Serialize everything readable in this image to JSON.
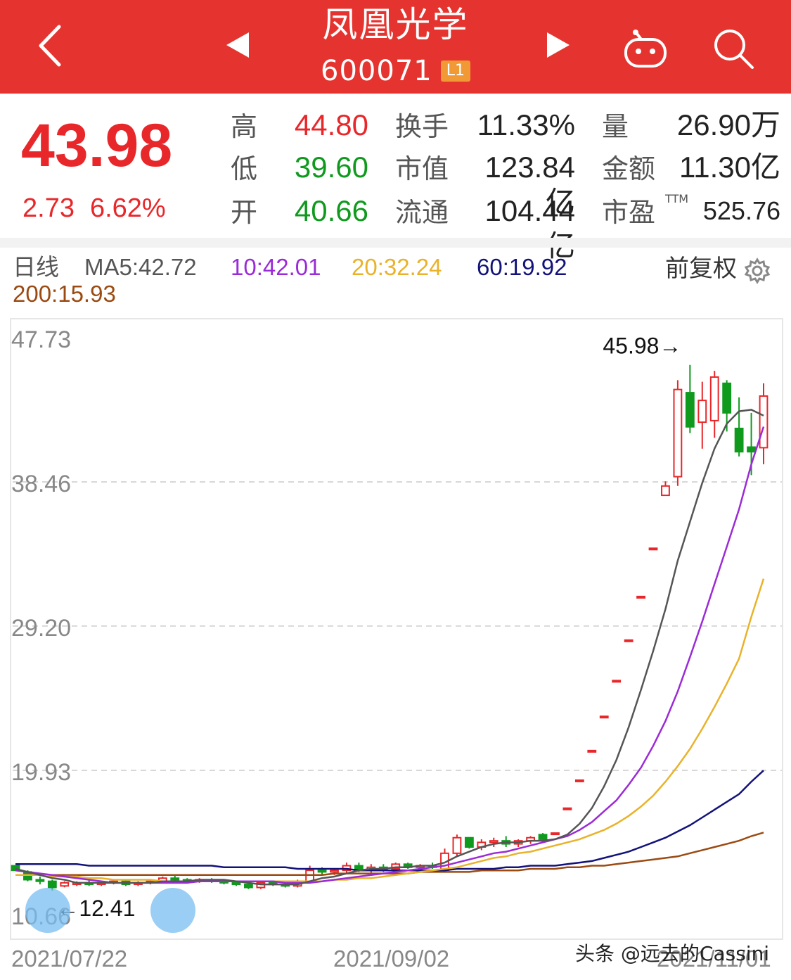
{
  "header": {
    "title": "凤凰光学",
    "code": "600071",
    "level": "L1",
    "icons": [
      "back-chevron-icon",
      "prev-triangle-icon",
      "next-triangle-icon",
      "robot-icon",
      "search-icon"
    ]
  },
  "quote": {
    "price": "43.98",
    "change": "2.73",
    "change_pct": "6.62%",
    "high_label": "高",
    "high": "44.80",
    "low_label": "低",
    "low": "39.60",
    "open_label": "开",
    "open": "40.66",
    "turnover_label": "换手",
    "turnover": "11.33%",
    "mcap_label": "市值",
    "mcap": "123.84亿",
    "float_label": "流通",
    "float": "104.44亿",
    "volume_label": "量",
    "volume": "26.90万",
    "amount_label": "金额",
    "amount": "11.30亿",
    "pe_label": "市盈",
    "pe_sup": "TTM",
    "pe": "525.76",
    "colors": {
      "up": "#e8272a",
      "down": "#0f9a1e"
    }
  },
  "ma": {
    "period": "日线",
    "ma5": "MA5:42.72",
    "ma10": "10:42.01",
    "ma20": "20:32.24",
    "ma60": "60:19.92",
    "ma200": "200:15.93",
    "adjust": "前复权",
    "colors": {
      "ma5": "#555555",
      "ma10": "#9b2bd6",
      "ma20": "#e9b22a",
      "ma60": "#12127a",
      "ma200": "#9b4a12"
    }
  },
  "chart_data": {
    "type": "candlestick",
    "y_ticks": [
      "47.73",
      "38.46",
      "29.20",
      "19.93",
      "10.66"
    ],
    "x_ticks": [
      "2021/07/22",
      "2021/09/02",
      "2021/11/01"
    ],
    "ylim": [
      10.66,
      47.73
    ],
    "annotations": {
      "high": "45.98→",
      "low": "←12.41"
    },
    "candles": [
      [
        13.8,
        13.8,
        13.5,
        13.5
      ],
      [
        13.4,
        13.5,
        12.8,
        12.9
      ],
      [
        12.9,
        13.1,
        12.6,
        12.8
      ],
      [
        12.8,
        12.9,
        12.2,
        12.4
      ],
      [
        12.5,
        12.8,
        12.41,
        12.7
      ],
      [
        12.6,
        12.8,
        12.5,
        12.7
      ],
      [
        12.7,
        12.9,
        12.5,
        12.6
      ],
      [
        12.6,
        12.8,
        12.5,
        12.7
      ],
      [
        12.7,
        12.9,
        12.6,
        12.8
      ],
      [
        12.8,
        12.9,
        12.5,
        12.6
      ],
      [
        12.6,
        12.8,
        12.5,
        12.7
      ],
      [
        12.7,
        12.9,
        12.6,
        12.8
      ],
      [
        12.8,
        13.1,
        12.7,
        13.0
      ],
      [
        13.0,
        13.2,
        12.8,
        12.9
      ],
      [
        12.9,
        13.0,
        12.7,
        12.8
      ],
      [
        12.8,
        13.0,
        12.7,
        12.9
      ],
      [
        12.9,
        13.0,
        12.7,
        12.8
      ],
      [
        12.8,
        12.9,
        12.6,
        12.7
      ],
      [
        12.7,
        12.8,
        12.5,
        12.6
      ],
      [
        12.6,
        12.7,
        12.3,
        12.4
      ],
      [
        12.4,
        12.8,
        12.3,
        12.7
      ],
      [
        12.7,
        12.8,
        12.5,
        12.6
      ],
      [
        12.6,
        12.7,
        12.4,
        12.5
      ],
      [
        12.5,
        12.9,
        12.4,
        12.8
      ],
      [
        12.8,
        13.8,
        12.7,
        13.5
      ],
      [
        13.5,
        13.7,
        13.2,
        13.4
      ],
      [
        13.4,
        13.6,
        13.2,
        13.5
      ],
      [
        13.5,
        14.0,
        13.3,
        13.8
      ],
      [
        13.8,
        14.0,
        13.4,
        13.5
      ],
      [
        13.5,
        13.9,
        13.3,
        13.7
      ],
      [
        13.7,
        13.9,
        13.4,
        13.6
      ],
      [
        13.6,
        14.0,
        13.5,
        13.9
      ],
      [
        13.9,
        14.0,
        13.6,
        13.7
      ],
      [
        13.7,
        13.9,
        13.5,
        13.8
      ],
      [
        13.8,
        14.0,
        13.6,
        13.7
      ],
      [
        13.5,
        14.9,
        13.4,
        14.6
      ],
      [
        14.6,
        15.8,
        14.4,
        15.6
      ],
      [
        15.6,
        15.6,
        14.9,
        15.0
      ],
      [
        15.0,
        15.5,
        14.8,
        15.3
      ],
      [
        15.3,
        15.6,
        15.0,
        15.4
      ],
      [
        15.4,
        15.7,
        15.0,
        15.2
      ],
      [
        15.2,
        15.5,
        15.0,
        15.4
      ],
      [
        15.4,
        15.7,
        15.2,
        15.6
      ],
      [
        15.8,
        15.9,
        15.3,
        15.5
      ],
      [
        15.9,
        15.9,
        15.9,
        15.9
      ],
      [
        17.5,
        17.5,
        17.5,
        17.5
      ],
      [
        19.3,
        19.3,
        19.3,
        19.3
      ],
      [
        21.2,
        21.2,
        21.2,
        21.2
      ],
      [
        23.4,
        23.4,
        23.4,
        23.4
      ],
      [
        25.7,
        25.7,
        25.7,
        25.7
      ],
      [
        28.3,
        28.3,
        28.3,
        28.3
      ],
      [
        31.1,
        31.1,
        31.1,
        31.1
      ],
      [
        34.2,
        34.2,
        34.2,
        34.2
      ],
      [
        37.6,
        38.5,
        37.6,
        38.2
      ],
      [
        38.8,
        45.0,
        38.2,
        44.4
      ],
      [
        44.2,
        45.98,
        41.6,
        42.0
      ],
      [
        42.3,
        44.9,
        40.6,
        43.7
      ],
      [
        42.4,
        45.6,
        41.3,
        45.2
      ],
      [
        44.8,
        45.0,
        41.7,
        42.9
      ],
      [
        41.9,
        43.9,
        40.1,
        40.4
      ],
      [
        40.7,
        42.9,
        38.9,
        40.4
      ],
      [
        40.66,
        44.8,
        39.6,
        43.98
      ]
    ],
    "ma_series": {
      "ma5": [
        13.6,
        13.4,
        13.2,
        13.0,
        12.9,
        12.7,
        12.7,
        12.7,
        12.7,
        12.7,
        12.7,
        12.7,
        12.8,
        12.8,
        12.8,
        12.9,
        12.9,
        12.9,
        12.8,
        12.7,
        12.6,
        12.6,
        12.6,
        12.6,
        12.8,
        13.0,
        13.1,
        13.3,
        13.5,
        13.6,
        13.6,
        13.7,
        13.7,
        13.8,
        13.8,
        14.0,
        14.4,
        14.7,
        15.0,
        15.2,
        15.3,
        15.3,
        15.4,
        15.4,
        15.5,
        15.8,
        16.5,
        17.5,
        18.9,
        20.6,
        22.7,
        25.1,
        27.6,
        30.3,
        33.4,
        35.9,
        38.4,
        40.6,
        42.2,
        43.0,
        43.1,
        42.72
      ],
      "ma10": [
        13.5,
        13.4,
        13.3,
        13.2,
        13.1,
        13.0,
        12.9,
        12.8,
        12.7,
        12.7,
        12.7,
        12.7,
        12.7,
        12.7,
        12.7,
        12.8,
        12.8,
        12.8,
        12.8,
        12.8,
        12.8,
        12.8,
        12.7,
        12.7,
        12.7,
        12.8,
        12.9,
        13.0,
        13.1,
        13.2,
        13.3,
        13.4,
        13.5,
        13.6,
        13.7,
        13.8,
        14.0,
        14.2,
        14.4,
        14.6,
        14.7,
        14.9,
        15.1,
        15.3,
        15.5,
        15.7,
        16.1,
        16.6,
        17.3,
        18.0,
        19.0,
        20.1,
        21.5,
        23.1,
        25.0,
        27.2,
        29.5,
        31.9,
        34.3,
        36.7,
        39.6,
        42.01
      ],
      "ma20": [
        13.2,
        13.2,
        13.2,
        13.1,
        13.1,
        13.1,
        13.0,
        13.0,
        12.9,
        12.9,
        12.9,
        12.9,
        12.8,
        12.8,
        12.8,
        12.8,
        12.8,
        12.8,
        12.8,
        12.8,
        12.8,
        12.8,
        12.8,
        12.8,
        12.8,
        12.8,
        12.9,
        12.9,
        13.0,
        13.0,
        13.1,
        13.2,
        13.3,
        13.4,
        13.5,
        13.6,
        13.7,
        13.9,
        14.1,
        14.3,
        14.4,
        14.6,
        14.7,
        14.9,
        15.1,
        15.3,
        15.5,
        15.8,
        16.1,
        16.5,
        17.0,
        17.6,
        18.3,
        19.2,
        20.2,
        21.3,
        22.6,
        24.0,
        25.5,
        27.1,
        29.8,
        32.24
      ],
      "ma60": [
        13.9,
        13.9,
        13.9,
        13.9,
        13.9,
        13.9,
        13.8,
        13.8,
        13.8,
        13.8,
        13.8,
        13.8,
        13.8,
        13.8,
        13.8,
        13.8,
        13.8,
        13.7,
        13.7,
        13.7,
        13.7,
        13.7,
        13.7,
        13.6,
        13.6,
        13.6,
        13.6,
        13.6,
        13.5,
        13.5,
        13.5,
        13.5,
        13.5,
        13.5,
        13.5,
        13.5,
        13.6,
        13.6,
        13.6,
        13.6,
        13.7,
        13.7,
        13.8,
        13.8,
        13.8,
        13.9,
        14.0,
        14.1,
        14.3,
        14.5,
        14.7,
        15.0,
        15.3,
        15.6,
        16.0,
        16.4,
        16.9,
        17.4,
        17.9,
        18.4,
        19.2,
        19.92
      ],
      "ma200": [
        13.2,
        13.2,
        13.2,
        13.2,
        13.2,
        13.2,
        13.2,
        13.2,
        13.2,
        13.2,
        13.2,
        13.2,
        13.2,
        13.2,
        13.2,
        13.2,
        13.2,
        13.2,
        13.2,
        13.2,
        13.2,
        13.2,
        13.2,
        13.2,
        13.2,
        13.2,
        13.3,
        13.3,
        13.3,
        13.3,
        13.3,
        13.3,
        13.3,
        13.4,
        13.4,
        13.4,
        13.4,
        13.4,
        13.5,
        13.5,
        13.5,
        13.5,
        13.6,
        13.6,
        13.6,
        13.7,
        13.7,
        13.8,
        13.8,
        13.9,
        14.0,
        14.1,
        14.2,
        14.3,
        14.4,
        14.6,
        14.8,
        15.0,
        15.2,
        15.4,
        15.7,
        15.93
      ]
    }
  },
  "watermark": "头条 @远去的Cassini"
}
